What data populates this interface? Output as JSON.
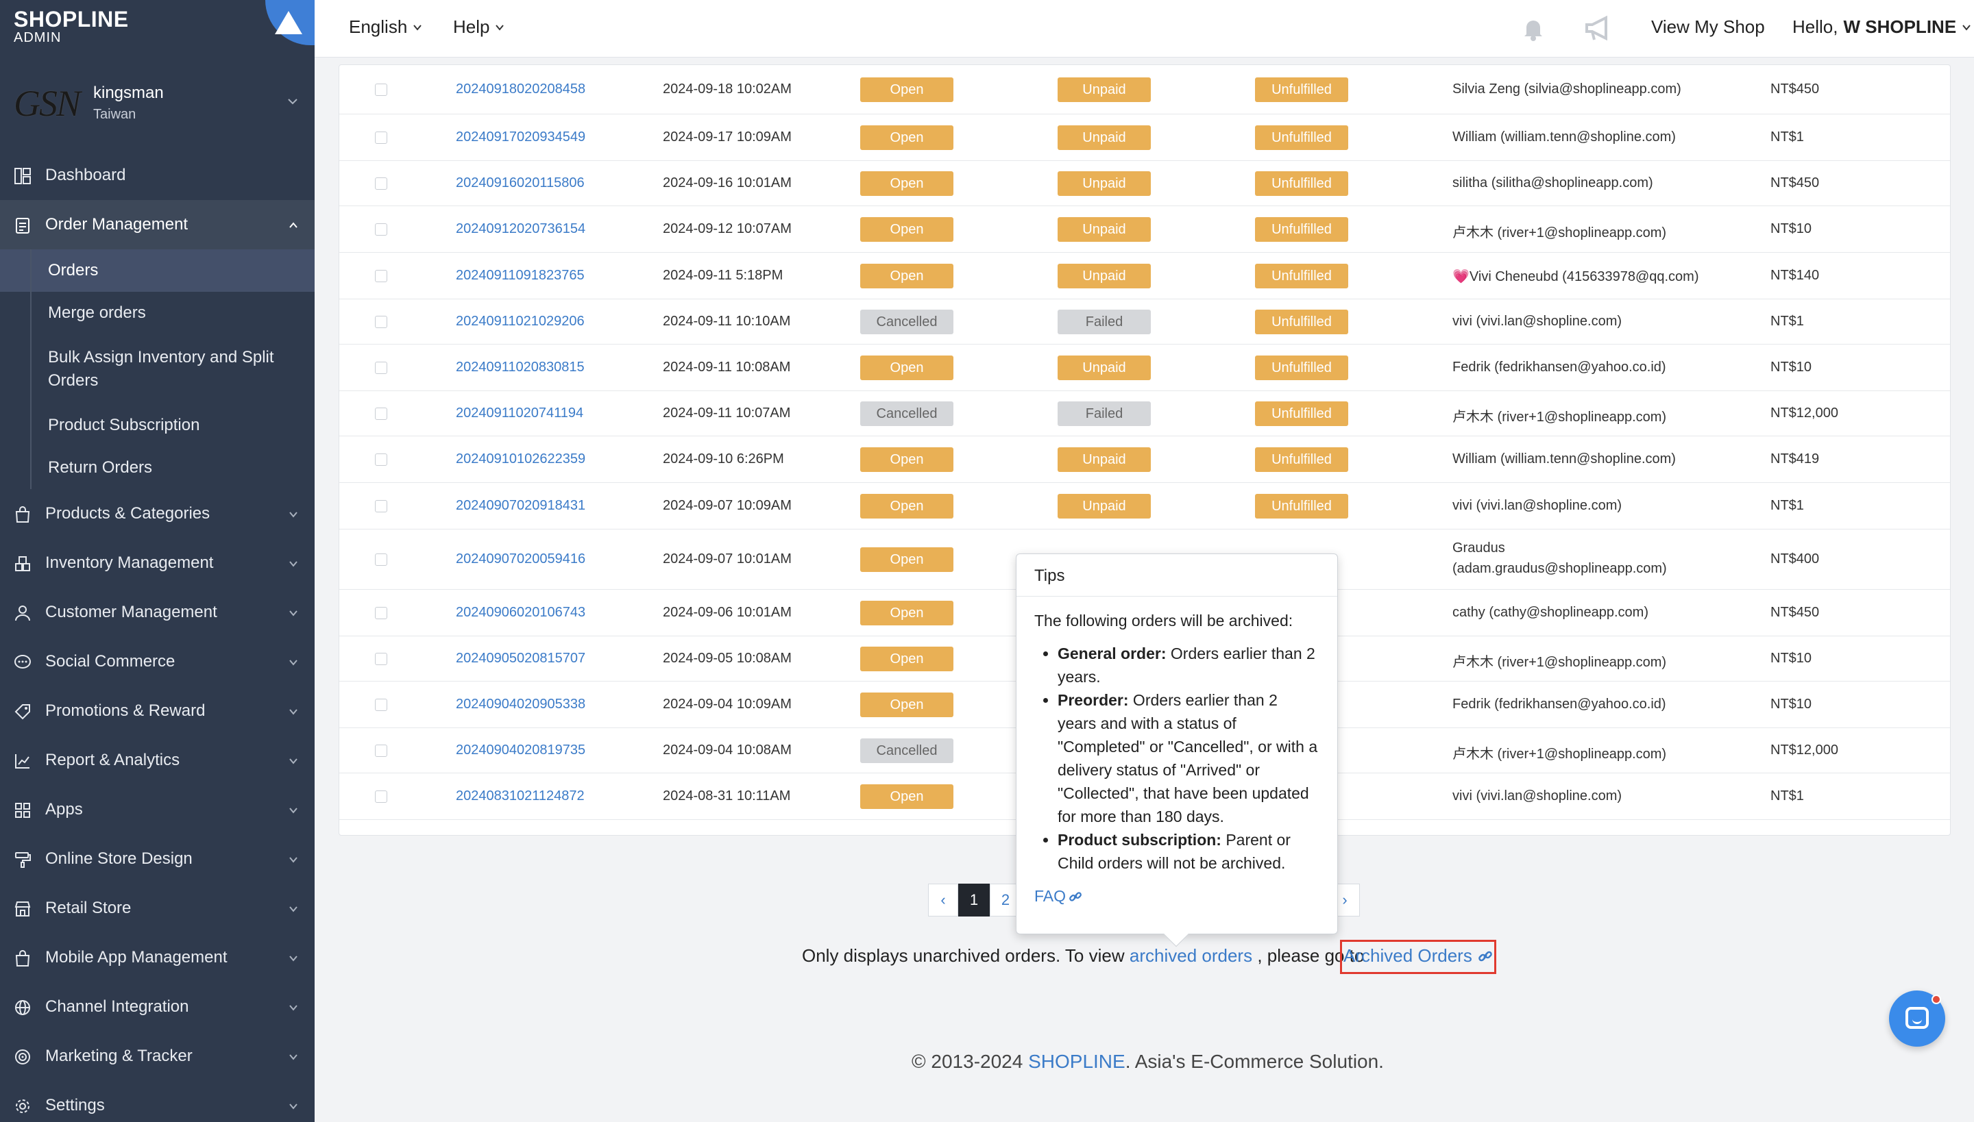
{
  "brand": {
    "name": "SHOPLINE",
    "sub": "ADMIN"
  },
  "store": {
    "logo_text": "GSN",
    "name": "kingsman",
    "country": "Taiwan"
  },
  "nav": {
    "dashboard": "Dashboard",
    "order_management": "Order Management",
    "orders_sub": [
      "Orders",
      "Merge orders",
      "Bulk Assign Inventory and Split",
      "Orders",
      "Product Subscription",
      "Return Orders"
    ],
    "products": "Products & Categories",
    "inventory": "Inventory Management",
    "customer": "Customer Management",
    "social": "Social Commerce",
    "promotions": "Promotions & Reward",
    "report": "Report & Analytics",
    "apps": "Apps",
    "online_store": "Online Store Design",
    "retail": "Retail Store",
    "mobile_app": "Mobile App Management",
    "channel": "Channel Integration",
    "marketing": "Marketing & Tracker",
    "settings": "Settings"
  },
  "topbar": {
    "language": "English",
    "help": "Help",
    "view_shop": "View My Shop",
    "hello": "Hello,",
    "user": "W SHOPLINE"
  },
  "orders": [
    {
      "id": "20240918020208458",
      "date": "2024-09-18 10:02AM",
      "status": "Open",
      "payment": "Unpaid",
      "delivery": "Unfulfilled",
      "customer": "Silvia Zeng (silvia@shoplineapp.com)",
      "total": "NT$450"
    },
    {
      "id": "20240917020934549",
      "date": "2024-09-17 10:09AM",
      "status": "Open",
      "payment": "Unpaid",
      "delivery": "Unfulfilled",
      "customer": "William (william.tenn@shopline.com)",
      "total": "NT$1"
    },
    {
      "id": "20240916020115806",
      "date": "2024-09-16 10:01AM",
      "status": "Open",
      "payment": "Unpaid",
      "delivery": "Unfulfilled",
      "customer": "silitha (silitha@shoplineapp.com)",
      "total": "NT$450"
    },
    {
      "id": "20240912020736154",
      "date": "2024-09-12 10:07AM",
      "status": "Open",
      "payment": "Unpaid",
      "delivery": "Unfulfilled",
      "customer": "卢木木 (river+1@shoplineapp.com)",
      "total": "NT$10"
    },
    {
      "id": "20240911091823765",
      "date": "2024-09-11 5:18PM",
      "status": "Open",
      "payment": "Unpaid",
      "delivery": "Unfulfilled",
      "customer": "💗Vivi Cheneubd (415633978@qq.com)",
      "total": "NT$140"
    },
    {
      "id": "20240911021029206",
      "date": "2024-09-11 10:10AM",
      "status": "Cancelled",
      "payment": "Failed",
      "delivery": "Unfulfilled",
      "customer": "vivi (vivi.lan@shopline.com)",
      "total": "NT$1"
    },
    {
      "id": "20240911020830815",
      "date": "2024-09-11 10:08AM",
      "status": "Open",
      "payment": "Unpaid",
      "delivery": "Unfulfilled",
      "customer": "Fedrik (fedrikhansen@yahoo.co.id)",
      "total": "NT$10"
    },
    {
      "id": "20240911020741194",
      "date": "2024-09-11 10:07AM",
      "status": "Cancelled",
      "payment": "Failed",
      "delivery": "Unfulfilled",
      "customer": "卢木木 (river+1@shoplineapp.com)",
      "total": "NT$12,000"
    },
    {
      "id": "20240910102622359",
      "date": "2024-09-10 6:26PM",
      "status": "Open",
      "payment": "Unpaid",
      "delivery": "Unfulfilled",
      "customer": "William (william.tenn@shopline.com)",
      "total": "NT$419"
    },
    {
      "id": "20240907020918431",
      "date": "2024-09-07 10:09AM",
      "status": "Open",
      "payment": "Unpaid",
      "delivery": "Unfulfilled",
      "customer": "vivi (vivi.lan@shopline.com)",
      "total": "NT$1"
    },
    {
      "id": "20240907020059416",
      "date": "2024-09-07 10:01AM",
      "status": "Open",
      "customer": "Graudus",
      "customer2": "(adam.graudus@shoplineapp.com)",
      "total": "NT$400"
    },
    {
      "id": "20240906020106743",
      "date": "2024-09-06 10:01AM",
      "status": "Open",
      "customer": "cathy (cathy@shoplineapp.com)",
      "total": "NT$450"
    },
    {
      "id": "20240905020815707",
      "date": "2024-09-05 10:08AM",
      "status": "Open",
      "customer": "卢木木 (river+1@shoplineapp.com)",
      "total": "NT$10"
    },
    {
      "id": "20240904020905338",
      "date": "2024-09-04 10:09AM",
      "status": "Open",
      "customer": "Fedrik (fedrikhansen@yahoo.co.id)",
      "total": "NT$10"
    },
    {
      "id": "20240904020819735",
      "date": "2024-09-04 10:08AM",
      "status": "Cancelled",
      "customer": "卢木木 (river+1@shoplineapp.com)",
      "total": "NT$12,000"
    },
    {
      "id": "20240831021124872",
      "date": "2024-08-31 10:11AM",
      "status": "Open",
      "customer": "vivi (vivi.lan@shopline.com)",
      "total": "NT$1"
    }
  ],
  "pagination": {
    "prev": "‹",
    "page1": "1",
    "page2": "2",
    "next": "›"
  },
  "archive": {
    "text1": "Only displays unarchived orders. To view",
    "link1": "archived orders",
    "text2": ", please go to",
    "link2": "Archived Orders"
  },
  "footer": {
    "copyright": "© 2013-2024",
    "brand": "SHOPLINE",
    "tagline": ". Asia's E-Commerce Solution."
  },
  "tips": {
    "title": "Tips",
    "intro": "The following orders will be archived:",
    "items": [
      {
        "label": "General order:",
        "text": " Orders earlier than 2 years."
      },
      {
        "label": "Preorder:",
        "text": " Orders earlier than 2 years and with a status of \"Completed\" or \"Cancelled\", or with a delivery status of \"Arrived\" or \"Collected\", that have been updated for more than 180 days."
      },
      {
        "label": "Product subscription:",
        "text": " Parent or Child orders will not be archived."
      }
    ],
    "faq": "FAQ"
  },
  "colors": {
    "sidebar": "#2f3a4d",
    "accent": "#3b7bc8",
    "badge_orange": "#e9b055",
    "badge_grey": "#d5d7da",
    "highlight": "#e03a2f"
  }
}
